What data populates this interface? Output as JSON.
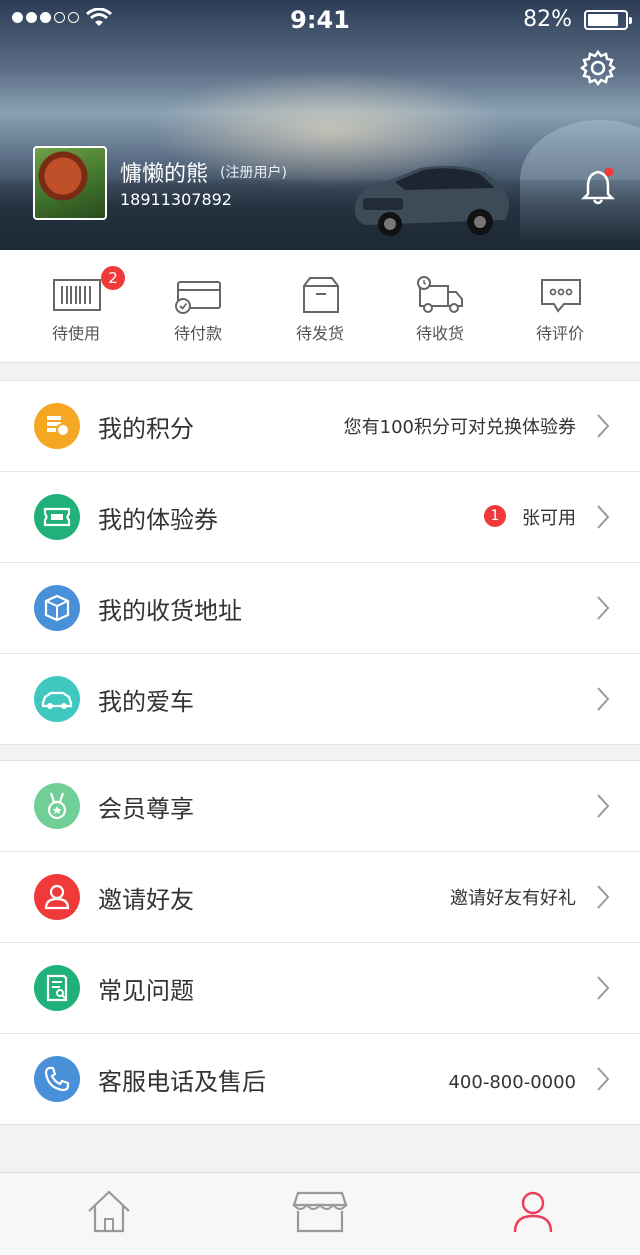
{
  "status": {
    "time": "9:41",
    "battery": "82%",
    "battery_level": 0.82
  },
  "profile": {
    "name": "慵懒的熊",
    "tag": "(注册用户)",
    "phone": "18911307892"
  },
  "orders": [
    {
      "label": "待使用",
      "badge": "2"
    },
    {
      "label": "待付款"
    },
    {
      "label": "待发货"
    },
    {
      "label": "待收货"
    },
    {
      "label": "待评价"
    }
  ],
  "menu1": [
    {
      "title": "我的积分",
      "sub": "您有100积分可对兑换体验券",
      "color": "#f5a623"
    },
    {
      "title": "我的体验券",
      "count": "1",
      "sub": "张可用",
      "color": "#20b07a"
    },
    {
      "title": "我的收货地址",
      "color": "#4a90d9"
    },
    {
      "title": "我的爱车",
      "color": "#3ec8c0"
    }
  ],
  "menu2": [
    {
      "title": "会员尊享",
      "color": "#6fcf97"
    },
    {
      "title": "邀请好友",
      "sub": "邀请好友有好礼",
      "color": "#f03a3a"
    },
    {
      "title": "常见问题",
      "color": "#20b07a"
    },
    {
      "title": "客服电话及售后",
      "sub": "400-800-0000",
      "color": "#4a90d9"
    }
  ],
  "tabs": [
    {
      "name": "home",
      "icon": "home-icon"
    },
    {
      "name": "store",
      "icon": "store-icon"
    },
    {
      "name": "profile",
      "icon": "user-icon",
      "active": true,
      "active_color": "#ef3b5a"
    }
  ]
}
